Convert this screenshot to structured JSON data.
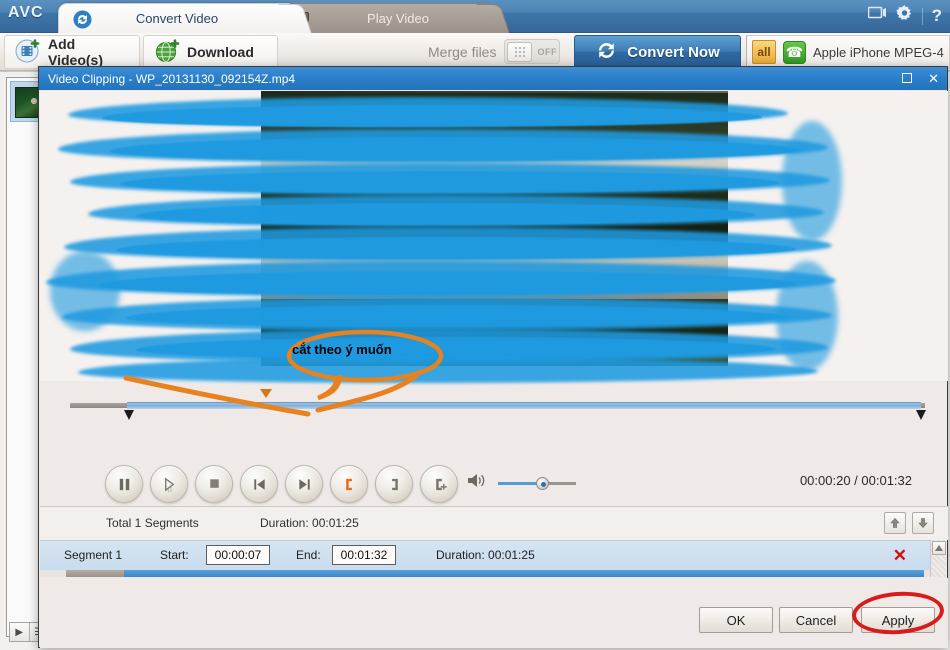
{
  "app": {
    "brand": "AVC",
    "tabs": [
      {
        "label": "Convert Video",
        "icon": "convert-icon",
        "active": true
      },
      {
        "label": "Play Video",
        "icon": "play-video-icon",
        "active": false
      }
    ],
    "window_icons": [
      "monitor-icon",
      "gear-icon",
      "help-icon"
    ],
    "help_glyph": "?"
  },
  "toolbar": {
    "add_videos_label": "Add Video(s)",
    "download_label": "Download",
    "merge_label": "Merge files",
    "merge_state": "OFF",
    "convert_label": "Convert Now",
    "profile_badge": "all",
    "profile_label": "Apple iPhone MPEG-4"
  },
  "dialog": {
    "title": "Video Clipping - WP_20131130_092154Z.mp4",
    "maximize_icon": "maximize-icon",
    "close_icon": "close-icon",
    "timecode": "00:00:20 / 00:01:32",
    "controls": [
      {
        "name": "pause-button",
        "icon": "pause-icon"
      },
      {
        "name": "play-frame-button",
        "icon": "play-frame-icon"
      },
      {
        "name": "stop-button",
        "icon": "stop-icon"
      },
      {
        "name": "previous-button",
        "icon": "skip-previous-icon"
      },
      {
        "name": "next-button",
        "icon": "skip-next-icon"
      },
      {
        "name": "set-start-button",
        "icon": "mark-start-icon"
      },
      {
        "name": "set-end-button",
        "icon": "mark-end-icon"
      },
      {
        "name": "add-segment-button",
        "icon": "add-segment-icon"
      }
    ],
    "volume": {
      "icon": "volume-icon",
      "percent": 56
    },
    "segments_header": {
      "total_label": "Total 1 Segments",
      "duration_label": "Duration: 00:01:25",
      "move_up_icon": "arrow-up-icon",
      "move_down_icon": "arrow-down-icon"
    },
    "segments": [
      {
        "name": "Segment 1",
        "start_label": "Start:",
        "start_value": "00:00:07",
        "end_label": "End:",
        "end_value": "00:01:32",
        "duration_label": "Duration: 00:01:25",
        "delete_glyph": "✕"
      }
    ],
    "footer": {
      "ok_label": "OK",
      "cancel_label": "Cancel",
      "apply_label": "Apply"
    }
  },
  "annotations": {
    "callout_text": "cắt theo ý muốn",
    "callout_color": "#e8821e",
    "highlight_color": "#1f9ae0",
    "apply_ring_color": "#d81c1c"
  },
  "sidebar": {
    "thumbnail_name": "video-thumbnail",
    "footer_buttons": [
      "play-mode-icon",
      "list-mode-icon"
    ]
  },
  "colors": {
    "accent_blue": "#2b7fc8",
    "title_blue": "#3f76a9",
    "dialog_bg": "#efeae8",
    "selection_blue": "#c9dcee"
  }
}
